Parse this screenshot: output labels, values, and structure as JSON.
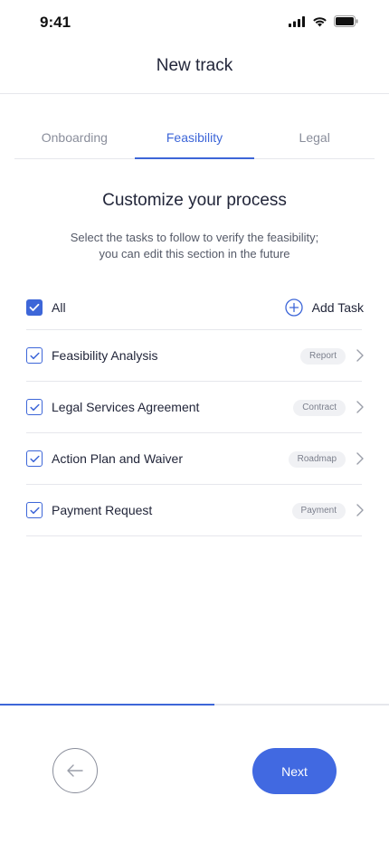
{
  "status_bar": {
    "time": "9:41"
  },
  "header": {
    "title": "New track"
  },
  "tabs": [
    {
      "label": "Onboarding",
      "active": false
    },
    {
      "label": "Feasibility",
      "active": true
    },
    {
      "label": "Legal",
      "active": false
    }
  ],
  "section": {
    "title": "Customize your process",
    "subtitle_line1": "Select the tasks to follow to verify the feasibility;",
    "subtitle_line2": "you can edit this section in the future"
  },
  "all_row": {
    "label": "All",
    "checked": true,
    "add_task_label": "Add Task"
  },
  "tasks": [
    {
      "label": "Feasibility Analysis",
      "badge": "Report",
      "checked": true
    },
    {
      "label": "Legal Services Agreement",
      "badge": "Contract",
      "checked": true
    },
    {
      "label": "Action Plan and Waiver",
      "badge": "Roadmap",
      "checked": true
    },
    {
      "label": "Payment Request",
      "badge": "Payment",
      "checked": true
    }
  ],
  "progress": {
    "fraction": 0.55
  },
  "footer": {
    "next_label": "Next"
  },
  "colors": {
    "accent": "#3d66d8",
    "button": "#4169e1",
    "divider": "#e6e7ec"
  }
}
